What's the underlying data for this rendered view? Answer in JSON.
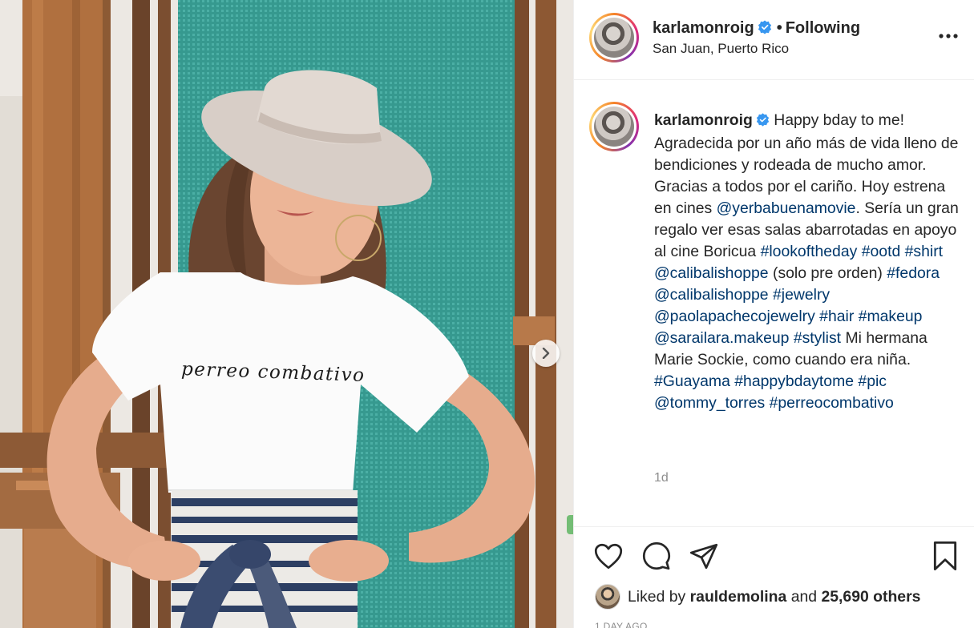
{
  "post": {
    "username": "karlamonroig",
    "separator": "•",
    "follow_status": "Following",
    "location": "San Juan, Puerto Rico",
    "more_icon": "more-options-icon",
    "shirt_text": "perreo combativo"
  },
  "caption": {
    "username": "karlamonroig",
    "seg1": " Happy bday to me! Agradecida por un año más de vida lleno de bendiciones y rodeada de mucho amor. Gracias a todos por el cariño. Hoy estrena en cines ",
    "m_yerba": "@yerbabuenamovie",
    "seg2": ". Sería un gran regalo ver esas salas abarrotadas en apoyo al cine Boricua ",
    "h_look": "#lookoftheday",
    "h_ootd": "#ootd",
    "h_shirt": "#shirt",
    "m_cali1": "@calibalishoppe",
    "seg3": " (solo pre orden) ",
    "h_fedora": "#fedora",
    "m_cali2": "@calibalishoppe",
    "h_jewelry": "#jewelry",
    "m_paola": "@paolapachecojewelry",
    "h_hair": "#hair",
    "h_makeup": "#makeup",
    "m_saraila": "@sarailara.makeup",
    "h_stylist": "#stylist",
    "seg4": " Mi hermana Marie Sockie, como cuando era niña. ",
    "h_guayama": "#Guayama",
    "h_happy": "#happybdaytome",
    "h_pic": "#pic",
    "m_tommy": "@tommy_torres",
    "h_perreo": "#perreocombativo",
    "time_ago": "1d"
  },
  "actions": {
    "like_icon": "heart-icon",
    "comment_icon": "comment-icon",
    "share_icon": "share-icon",
    "save_icon": "bookmark-icon"
  },
  "likes": {
    "prefix": "Liked by ",
    "user": "rauldemolina",
    "mid": " and ",
    "count": "25,690 others"
  },
  "date": "1 DAY AGO",
  "colors": {
    "link": "#00376b",
    "verified": "#3897f0",
    "muted": "#8e8e8e",
    "text": "#262626",
    "backdrop_teal": "#3fa59b"
  }
}
